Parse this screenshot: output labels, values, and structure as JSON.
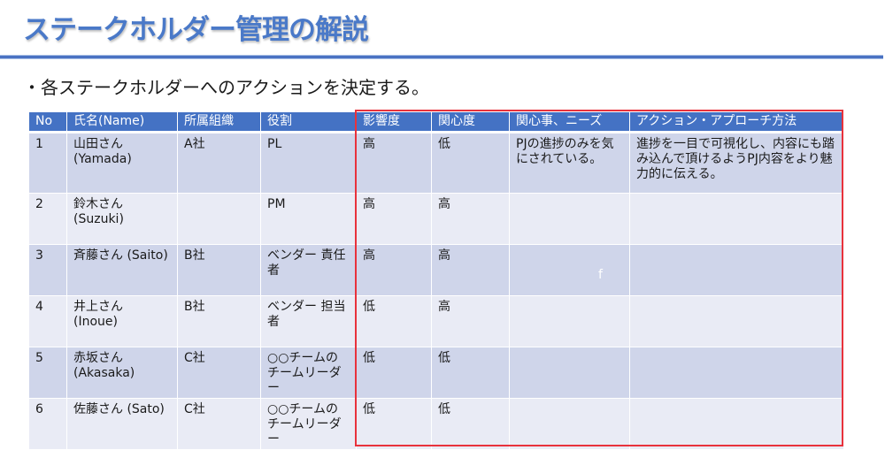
{
  "slide": {
    "title": "ステークホルダー管理の解説",
    "bullet": "・各ステークホルダーへのアクションを決定する。",
    "stray_char": "f",
    "colors": {
      "title": "#4a79c8",
      "header_bg": "#4472c4",
      "row_odd": "#cfd5ea",
      "row_even": "#e9ebf5",
      "highlight_frame": "#e8323c"
    }
  },
  "table": {
    "headers": [
      "No",
      "氏名(Name)",
      "所属組織",
      "役割",
      "影響度",
      "関心度",
      "関心事、ニーズ",
      "アクション・アプローチ方法"
    ],
    "rows": [
      {
        "no": "1",
        "name": "山田さん\n(Yamada)",
        "org": "A社",
        "role": "PL",
        "influence": "高",
        "interest": "低",
        "needs": "PJの進捗のみを気にされている。",
        "action": "進捗を一目で可視化し、内容にも踏み込んで頂けるようPJ内容をより魅力的に伝える。"
      },
      {
        "no": "2",
        "name": "鈴木さん\n(Suzuki)",
        "org": "",
        "role": "PM",
        "influence": "高",
        "interest": "高",
        "needs": "",
        "action": ""
      },
      {
        "no": "3",
        "name": "斉藤さん\n(Saito)",
        "org": "B社",
        "role": "ベンダー\n責任者",
        "influence": "高",
        "interest": "高",
        "needs": "",
        "action": ""
      },
      {
        "no": "4",
        "name": "井上さん\n(Inoue)",
        "org": "B社",
        "role": "ベンダー\n担当者",
        "influence": "低",
        "interest": "高",
        "needs": "",
        "action": ""
      },
      {
        "no": "5",
        "name": "赤坂さん\n(Akasaka)",
        "org": "C社",
        "role": "○○チームの\nチームリーダー",
        "influence": "低",
        "interest": "低",
        "needs": "",
        "action": ""
      },
      {
        "no": "6",
        "name": "佐藤さん\n(Sato)",
        "org": "C社",
        "role": "○○チームの\nチームリーダー",
        "influence": "低",
        "interest": "低",
        "needs": "",
        "action": ""
      }
    ]
  }
}
